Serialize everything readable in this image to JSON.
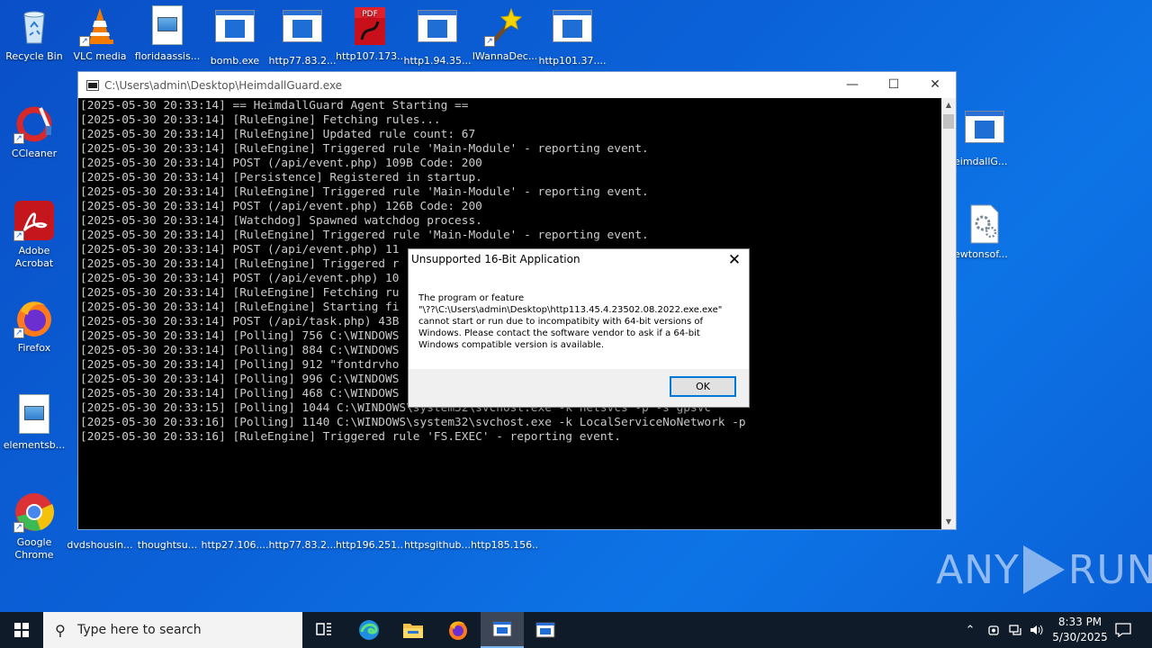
{
  "desktop": {
    "icons": [
      {
        "name": "recycle-bin",
        "label": "Recycle Bin"
      },
      {
        "name": "vlc-media",
        "label": "VLC media"
      },
      {
        "name": "floridaassis",
        "label": "floridaassis..."
      },
      {
        "name": "bomb-exe",
        "label": "bomb.exe"
      },
      {
        "name": "http77-83-2-top",
        "label": "http77.83.2..."
      },
      {
        "name": "http107-173",
        "label": "http107.173..."
      },
      {
        "name": "http1-94-35",
        "label": "http1.94.35..."
      },
      {
        "name": "iwannadec",
        "label": "IWannaDec..."
      },
      {
        "name": "http101-37",
        "label": "http101.37...."
      },
      {
        "name": "ccleaner",
        "label": "CCleaner"
      },
      {
        "name": "adobe-acrobat",
        "label": "Adobe Acrobat"
      },
      {
        "name": "firefox",
        "label": "Firefox"
      },
      {
        "name": "elementsb",
        "label": "elementsb..."
      },
      {
        "name": "google-chrome",
        "label": "Google Chrome"
      },
      {
        "name": "dvdshousin",
        "label": "dvdshousin..."
      },
      {
        "name": "thoughtsu",
        "label": "thoughtsu..."
      },
      {
        "name": "http27-106",
        "label": "http27.106...."
      },
      {
        "name": "http77-83-2-bottom",
        "label": "http77.83.2..."
      },
      {
        "name": "http196-251",
        "label": "http196.251..."
      },
      {
        "name": "httpsgithub",
        "label": "httpsgithub..."
      },
      {
        "name": "http185-156",
        "label": "http185.156..."
      },
      {
        "name": "heimdallg",
        "label": "eimdallG..."
      },
      {
        "name": "newtonsof",
        "label": "ewtonsof..."
      }
    ]
  },
  "console_window": {
    "title": "C:\\Users\\admin\\Desktop\\HeimdallGuard.exe",
    "minimize": "—",
    "maximize": "☐",
    "close": "✕",
    "lines": [
      "[2025-05-30 20:33:14] == HeimdallGuard Agent Starting ==",
      "[2025-05-30 20:33:14] [RuleEngine] Fetching rules...",
      "[2025-05-30 20:33:14] [RuleEngine] Updated rule count: 67",
      "[2025-05-30 20:33:14] [RuleEngine] Triggered rule 'Main-Module' - reporting event.",
      "[2025-05-30 20:33:14] POST (/api/event.php) 109B Code: 200",
      "[2025-05-30 20:33:14] [Persistence] Registered in startup.",
      "[2025-05-30 20:33:14] [RuleEngine] Triggered rule 'Main-Module' - reporting event.",
      "[2025-05-30 20:33:14] POST (/api/event.php) 126B Code: 200",
      "[2025-05-30 20:33:14] [Watchdog] Spawned watchdog process.",
      "[2025-05-30 20:33:14] [RuleEngine] Triggered rule 'Main-Module' - reporting event.",
      "[2025-05-30 20:33:14] POST (/api/event.php) 11",
      "[2025-05-30 20:33:14] [RuleEngine] Triggered r",
      "[2025-05-30 20:33:14] POST (/api/event.php) 10",
      "[2025-05-30 20:33:14] [RuleEngine] Fetching ru",
      "[2025-05-30 20:33:14] [RuleEngine] Starting fi",
      "[2025-05-30 20:33:14] POST (/api/task.php) 43B",
      "[2025-05-30 20:33:14] [Polling] 756 C:\\WINDOWS",
      "[2025-05-30 20:33:14] [Polling] 884 C:\\WINDOWS",
      "[2025-05-30 20:33:14] [Polling] 912 \"fontdrvho",
      "[2025-05-30 20:33:14] [Polling] 996 C:\\WINDOWS",
      "[2025-05-30 20:33:14] [Polling] 468 C:\\WINDOWS",
      "[2025-05-30 20:33:15] [Polling] 1044 C:\\WINDOWS\\system32\\svchost.exe -k netsvcs -p -s gpsvc",
      "[2025-05-30 20:33:16] [Polling] 1140 C:\\WINDOWS\\system32\\svchost.exe -k LocalServiceNoNetwork -p",
      "[2025-05-30 20:33:16] [RuleEngine] Triggered rule 'FS.EXEC' - reporting event."
    ]
  },
  "dialog": {
    "title": "Unsupported 16-Bit Application",
    "close": "✕",
    "message_lines": [
      "The program or feature",
      "\"\\??\\C:\\Users\\admin\\Desktop\\http113.45.4.23502.08.2022.exe.exe\"",
      "cannot start or run due to incompatibity with 64-bit versions of",
      "Windows. Please contact the software vendor to ask if a 64-bit",
      "Windows compatible version is available."
    ],
    "ok_label": "OK"
  },
  "watermark": {
    "left": "ANY",
    "right": "RUN"
  },
  "taskbar": {
    "search_placeholder": "Type here to search",
    "time": "8:33 PM",
    "date": "5/30/2025"
  }
}
